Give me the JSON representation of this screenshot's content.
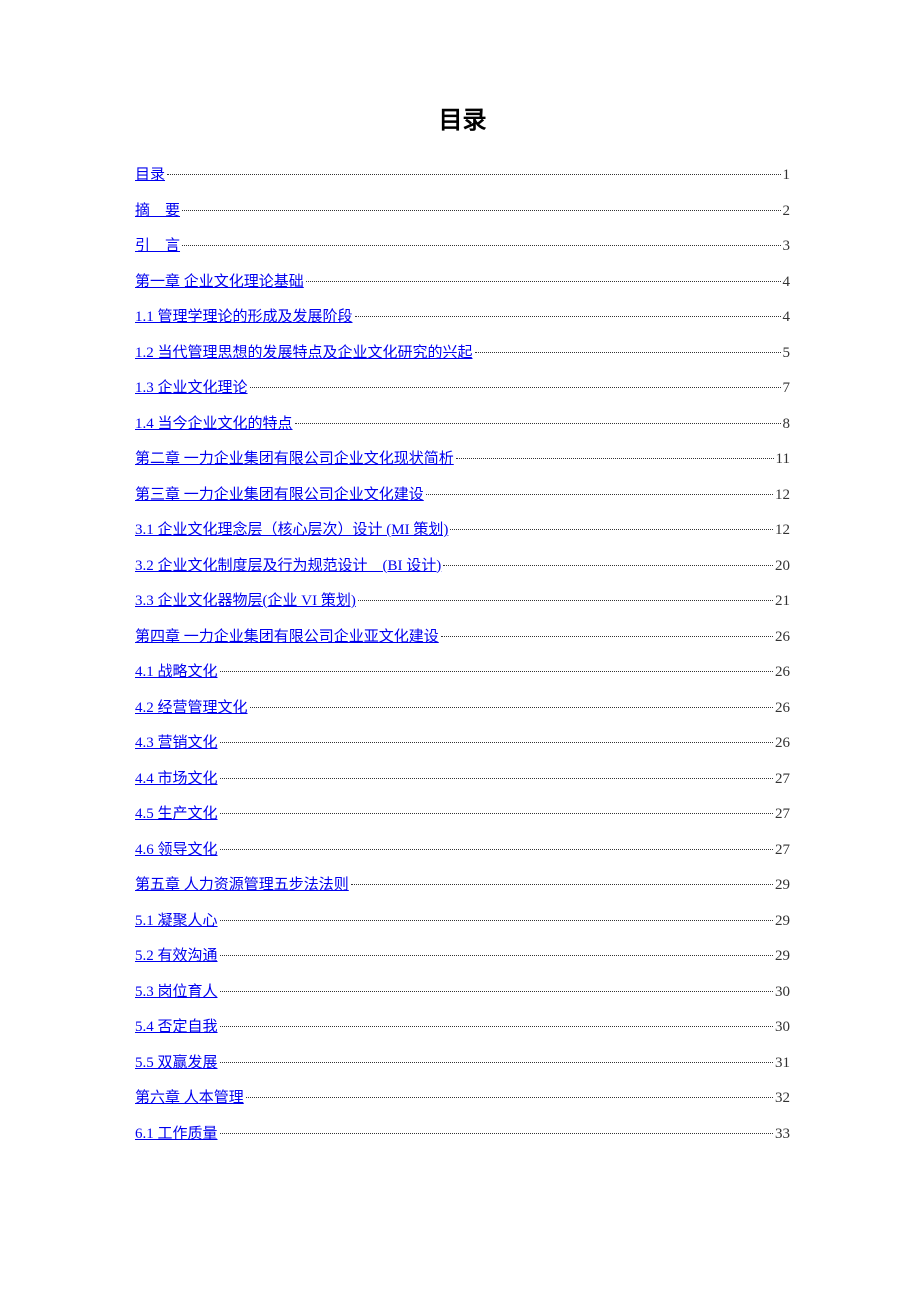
{
  "title": "目录",
  "toc": [
    {
      "label": "目录",
      "page": "1"
    },
    {
      "label": "摘　要",
      "page": "2"
    },
    {
      "label": "引　言",
      "page": "3"
    },
    {
      "label": "第一章  企业文化理论基础",
      "page": "4"
    },
    {
      "label": "1.1 管理学理论的形成及发展阶段",
      "page": "4"
    },
    {
      "label": "1.2 当代管理思想的发展特点及企业文化研究的兴起",
      "page": "5"
    },
    {
      "label": "1.3 企业文化理论",
      "page": "7"
    },
    {
      "label": "1.4 当今企业文化的特点",
      "page": "8"
    },
    {
      "label": "第二章  一力企业集团有限公司企业文化现状简析",
      "page": "11"
    },
    {
      "label": "第三章  一力企业集团有限公司企业文化建设",
      "page": "12"
    },
    {
      "label": "3.1 企业文化理念层（核心层次）设计  (MI 策划)",
      "page": "12"
    },
    {
      "label": "3.2 企业文化制度层及行为规范设计　(BI 设计)",
      "page": "20"
    },
    {
      "label": "3.3  企业文化器物层(企业 VI  策划)",
      "page": "21"
    },
    {
      "label": "第四章  一力企业集团有限公司企业亚文化建设",
      "page": "26"
    },
    {
      "label": "4.1 战略文化",
      "page": "26"
    },
    {
      "label": "4.2  经营管理文化",
      "page": "26"
    },
    {
      "label": "4.3  营销文化",
      "page": "26"
    },
    {
      "label": "4.4  市场文化",
      "page": "27"
    },
    {
      "label": "4.5  生产文化",
      "page": "27"
    },
    {
      "label": "4.6  领导文化",
      "page": "27"
    },
    {
      "label": "第五章  人力资源管理五步法法则",
      "page": "29"
    },
    {
      "label": "5.1  凝聚人心",
      "page": "29"
    },
    {
      "label": "5.2  有效沟通",
      "page": "29"
    },
    {
      "label": "5.3  岗位育人",
      "page": "30"
    },
    {
      "label": "5.4  否定自我",
      "page": "30"
    },
    {
      "label": "5.5  双赢发展",
      "page": "31"
    },
    {
      "label": "第六章  人本管理",
      "page": "32"
    },
    {
      "label": "6.1  工作质量",
      "page": "33"
    }
  ]
}
